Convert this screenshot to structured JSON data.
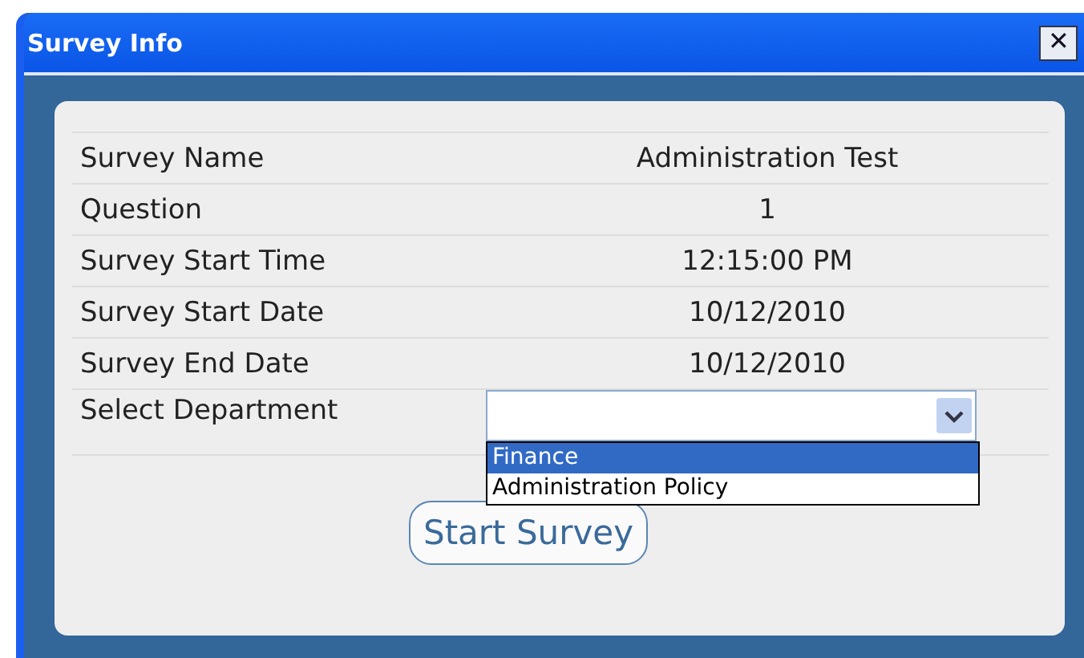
{
  "window": {
    "title": "Survey Info",
    "close_label": "✕"
  },
  "fields": [
    {
      "label": "Survey Name",
      "value": "Administration Test"
    },
    {
      "label": "Question",
      "value": "1"
    },
    {
      "label": "Survey Start Time",
      "value": "12:15:00 PM"
    },
    {
      "label": "Survey Start Date",
      "value": "10/12/2010"
    },
    {
      "label": "Survey End Date",
      "value": "10/12/2010"
    }
  ],
  "department": {
    "label": "Select Department",
    "expanded": true,
    "options": [
      {
        "label": "Finance",
        "selected": true
      },
      {
        "label": "Administration Policy",
        "selected": false
      }
    ]
  },
  "button": "Start Survey"
}
